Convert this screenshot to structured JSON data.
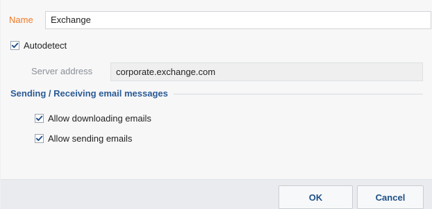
{
  "form": {
    "name_label": "Name",
    "name_value": "Exchange",
    "autodetect_label": "Autodetect",
    "autodetect_checked": true,
    "server_address_label": "Server address",
    "server_address_value": "corporate.exchange.com"
  },
  "section": {
    "title": "Sending / Receiving email messages",
    "allow_downloading_label": "Allow downloading emails",
    "allow_downloading_checked": true,
    "allow_sending_label": "Allow sending emails",
    "allow_sending_checked": true
  },
  "footer": {
    "ok_label": "OK",
    "cancel_label": "Cancel"
  },
  "colors": {
    "name_label": "#f07a24",
    "section_title": "#2a5a95",
    "button_text": "#1d4f88",
    "checkmark": "#1f4f8a"
  },
  "icons": {
    "checkbox": "checkmark-icon"
  }
}
